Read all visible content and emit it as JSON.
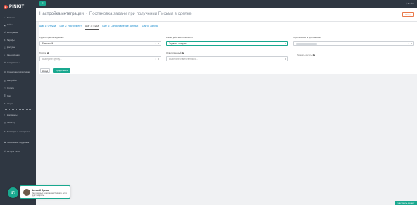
{
  "brand": {
    "logo_text": "PINKIT"
  },
  "topbar": {
    "menu_icon": "menu-icon",
    "exit_label": "Выйти"
  },
  "sidebar": {
    "items": [
      {
        "label": "Главная",
        "icon": "home-icon"
      },
      {
        "label": "Кейсы",
        "icon": "case-icon"
      },
      {
        "label": "Интеграции",
        "icon": "integration-icon"
      },
      {
        "label": "Тарифы",
        "icon": "tariff-icon"
      },
      {
        "label": "Доступы",
        "icon": "key-icon"
      },
      {
        "label": "Уведомления",
        "icon": "bell-icon"
      },
      {
        "label": "Инструменты",
        "icon": "wrench-icon"
      },
      {
        "label": "Статистика подписчиков",
        "icon": "chart-icon"
      },
      {
        "label": "Настройки",
        "icon": "gear-icon"
      },
      {
        "label": "Оплата",
        "icon": "card-icon"
      },
      {
        "label": "Логи",
        "icon": "log-icon"
      },
      {
        "label": "Акции",
        "icon": "gift-icon"
      }
    ],
    "items2": [
      {
        "label": "Документы",
        "icon": "doc-icon"
      },
      {
        "label": "Wiki/FAQ",
        "icon": "book-icon"
      },
      {
        "label": "Популярные интеграции",
        "icon": "star-icon"
      },
      {
        "label": "Техническая поддержка",
        "icon": "support-icon"
      },
      {
        "label": "API для Pinkit",
        "icon": "code-icon"
      }
    ]
  },
  "header": {
    "title": "Настройка интеграции",
    "subtitle": "Постановка задачи при получении Письма в сделке",
    "back_label": "Назад"
  },
  "tabs": [
    {
      "label": "Шаг 1: Откуда",
      "active": false
    },
    {
      "label": "Шаг 2: Инструмент",
      "active": false
    },
    {
      "label": "Шаг 3: Куда",
      "active": true
    },
    {
      "label": "Шаг 4: Сопоставление данных",
      "active": false
    },
    {
      "label": "Шаг 5: Запуск",
      "active": false
    }
  ],
  "form": {
    "dest_label": "Куда отправлять данные",
    "dest_value": "Битрикс24",
    "action_label": "Какое действие совершить",
    "action_value": "Задача - создать",
    "connect_label": "Подключение к приложению",
    "group_label": "Группа",
    "group_placeholder": "Выберите группу...",
    "responsible_label": "Ответственный",
    "responsible_placeholder": "Выберите ответственного...",
    "connect_note": "Изменить доступы"
  },
  "buttons": {
    "back": "Назад",
    "next": "Продолжить"
  },
  "chat": {
    "name": "Алексей Орлов",
    "message": "Рад помочь с интеграцией! Пишите, если будут вопросы."
  },
  "status_button": "Настроить виджет",
  "colors": {
    "accent": "#19a88f",
    "sidebar": "#2f3742",
    "link": "#1f8fcf",
    "warning": "#e9794a"
  }
}
